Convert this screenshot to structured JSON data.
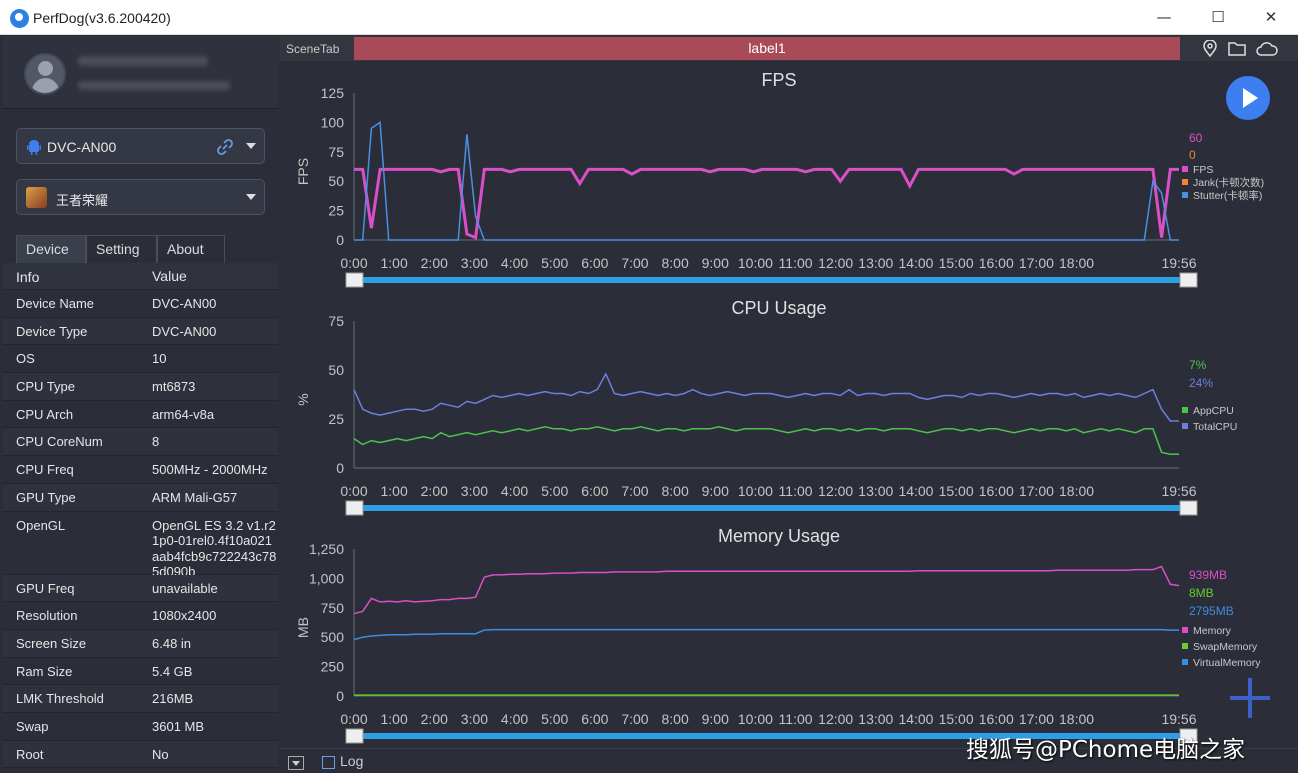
{
  "window": {
    "title": "PerfDog(v3.6.200420)",
    "minimize": "—",
    "maximize": "☐",
    "close": "✕"
  },
  "sidebar": {
    "device_select": {
      "value": "DVC-AN00"
    },
    "app_select": {
      "value": "王者荣耀"
    },
    "tabs": [
      {
        "label": "Device"
      },
      {
        "label": "Setting"
      },
      {
        "label": "About"
      }
    ],
    "table": {
      "headers": [
        "Info",
        "Value"
      ],
      "rows": [
        {
          "k": "Device Name",
          "v": "DVC-AN00"
        },
        {
          "k": "Device Type",
          "v": "DVC-AN00"
        },
        {
          "k": "OS",
          "v": "10"
        },
        {
          "k": "CPU Type",
          "v": "mt6873"
        },
        {
          "k": "CPU Arch",
          "v": "arm64-v8a"
        },
        {
          "k": "CPU CoreNum",
          "v": "8"
        },
        {
          "k": "CPU Freq",
          "v": "500MHz - 2000MHz"
        },
        {
          "k": "GPU Type",
          "v": "ARM Mali-G57"
        },
        {
          "k": "OpenGL",
          "v": "OpenGL ES 3.2 v1.r21p0-01rel0.4f10a021aab4fcb9c722243c785d090b"
        },
        {
          "k": "GPU Freq",
          "v": "unavailable"
        },
        {
          "k": "Resolution",
          "v": "1080x2400"
        },
        {
          "k": "Screen Size",
          "v": "6.48 in"
        },
        {
          "k": "Ram Size",
          "v": "5.4 GB"
        },
        {
          "k": "LMK Threshold",
          "v": "216MB"
        },
        {
          "k": "Swap",
          "v": "3601 MB"
        },
        {
          "k": "Root",
          "v": "No"
        }
      ]
    }
  },
  "main": {
    "scene_tab": "SceneTab",
    "label": "label1",
    "icons": [
      "location-icon",
      "folder-icon",
      "cloud-icon"
    ],
    "bottom": {
      "log_label": "Log"
    }
  },
  "watermark": "搜狐号@PChome电脑之家",
  "colors": {
    "fps": "#d94fc7",
    "jank": "#e8863a",
    "stutter": "#4a90e2",
    "app_cpu": "#4cc44c",
    "total_cpu": "#6c7fe0",
    "memory": "#d94fc7",
    "swap": "#66cc33",
    "virtual": "#3a8ee0",
    "accent": "#3d7ef0",
    "label_bar": "#a84a58"
  },
  "chart_data": [
    {
      "type": "line",
      "title": "FPS",
      "ylabel": "FPS",
      "ylim": [
        0,
        125
      ],
      "yticks": [
        "125",
        "100",
        "75",
        "50",
        "25",
        "0"
      ],
      "xticks": [
        "0:00",
        "1:00",
        "2:00",
        "3:00",
        "4:00",
        "5:00",
        "6:00",
        "7:00",
        "8:00",
        "9:00",
        "10:00",
        "11:00",
        "12:00",
        "13:00",
        "14:00",
        "15:00",
        "16:00",
        "17:00",
        "18:00",
        "19:56"
      ],
      "legend": [
        "FPS",
        "Jank(卡顿次数)",
        "Stutter(卡顿率)"
      ],
      "current_values": [
        "60",
        "0"
      ],
      "series": [
        {
          "name": "FPS",
          "values": [
            60,
            60,
            10,
            60,
            60,
            60,
            60,
            60,
            60,
            60,
            58,
            60,
            60,
            5,
            2,
            60,
            60,
            60,
            58,
            60,
            60,
            60,
            60,
            60,
            60,
            60,
            48,
            60,
            60,
            60,
            60,
            60,
            56,
            60,
            60,
            60,
            60,
            60,
            60,
            60,
            60,
            58,
            60,
            60,
            60,
            60,
            58,
            60,
            60,
            60,
            60,
            60,
            58,
            60,
            60,
            60,
            50,
            60,
            60,
            60,
            60,
            60,
            60,
            60,
            46,
            60,
            60,
            60,
            60,
            60,
            60,
            60,
            60,
            60,
            60,
            60,
            56,
            60,
            60,
            60,
            60,
            60,
            60,
            60,
            60,
            60,
            60,
            60,
            60,
            60,
            60,
            60,
            60,
            2,
            60,
            60
          ]
        },
        {
          "name": "Stutter(卡顿率)",
          "values": [
            0,
            0,
            95,
            100,
            0,
            0,
            0,
            0,
            0,
            0,
            0,
            0,
            0,
            90,
            20,
            0,
            0,
            0,
            0,
            0,
            0,
            0,
            0,
            0,
            0,
            0,
            0,
            0,
            0,
            0,
            0,
            0,
            0,
            0,
            0,
            0,
            0,
            0,
            0,
            0,
            0,
            0,
            0,
            0,
            0,
            0,
            0,
            0,
            0,
            0,
            0,
            0,
            0,
            0,
            0,
            0,
            0,
            0,
            0,
            0,
            0,
            0,
            0,
            0,
            0,
            0,
            0,
            0,
            0,
            0,
            0,
            0,
            0,
            0,
            0,
            0,
            0,
            0,
            0,
            0,
            0,
            0,
            0,
            0,
            0,
            0,
            0,
            0,
            0,
            0,
            0,
            0,
            50,
            40,
            0,
            0
          ]
        }
      ]
    },
    {
      "type": "line",
      "title": "CPU Usage",
      "ylabel": "%",
      "ylim": [
        0,
        75
      ],
      "yticks": [
        "75",
        "50",
        "25",
        "0"
      ],
      "xticks": [
        "0:00",
        "1:00",
        "2:00",
        "3:00",
        "4:00",
        "5:00",
        "6:00",
        "7:00",
        "8:00",
        "9:00",
        "10:00",
        "11:00",
        "12:00",
        "13:00",
        "14:00",
        "15:00",
        "16:00",
        "17:00",
        "18:00",
        "19:56"
      ],
      "legend": [
        "AppCPU",
        "TotalCPU"
      ],
      "current_values": [
        "7%",
        "24%"
      ],
      "series": [
        {
          "name": "AppCPU",
          "values": [
            15,
            12,
            14,
            13,
            14,
            15,
            14,
            15,
            16,
            15,
            18,
            16,
            17,
            18,
            17,
            18,
            19,
            18,
            19,
            20,
            19,
            20,
            21,
            20,
            20,
            19,
            20,
            20,
            21,
            20,
            19,
            20,
            20,
            21,
            20,
            19,
            20,
            20,
            19,
            20,
            20,
            20,
            21,
            20,
            19,
            20,
            20,
            20,
            20,
            19,
            18,
            19,
            20,
            19,
            20,
            20,
            19,
            20,
            19,
            20,
            20,
            19,
            20,
            20,
            20,
            19,
            18,
            19,
            20,
            20,
            19,
            20,
            19,
            20,
            20,
            19,
            18,
            19,
            20,
            19,
            20,
            20,
            19,
            20,
            18,
            19,
            20,
            19,
            20,
            19,
            18,
            20,
            20,
            8,
            7,
            7
          ]
        },
        {
          "name": "TotalCPU",
          "values": [
            40,
            30,
            28,
            27,
            28,
            29,
            30,
            30,
            29,
            30,
            33,
            32,
            31,
            34,
            33,
            35,
            37,
            36,
            37,
            38,
            37,
            38,
            39,
            38,
            38,
            37,
            39,
            38,
            40,
            48,
            38,
            37,
            38,
            39,
            38,
            37,
            38,
            37,
            38,
            40,
            38,
            37,
            38,
            39,
            38,
            37,
            38,
            38,
            38,
            37,
            36,
            37,
            38,
            37,
            38,
            38,
            37,
            40,
            37,
            38,
            38,
            37,
            38,
            38,
            38,
            36,
            35,
            36,
            37,
            37,
            36,
            38,
            37,
            38,
            38,
            37,
            36,
            37,
            38,
            37,
            38,
            38,
            37,
            38,
            36,
            37,
            38,
            37,
            38,
            37,
            36,
            38,
            40,
            30,
            24,
            24
          ]
        }
      ]
    },
    {
      "type": "line",
      "title": "Memory Usage",
      "ylabel": "MB",
      "ylim": [
        0,
        1250
      ],
      "yticks": [
        "1,250",
        "1,000",
        "750",
        "500",
        "250",
        "0"
      ],
      "xticks": [
        "0:00",
        "1:00",
        "2:00",
        "3:00",
        "4:00",
        "5:00",
        "6:00",
        "7:00",
        "8:00",
        "9:00",
        "10:00",
        "11:00",
        "12:00",
        "13:00",
        "14:00",
        "15:00",
        "16:00",
        "17:00",
        "18:00",
        "19:56"
      ],
      "legend": [
        "Memory",
        "SwapMemory",
        "VirtualMemory"
      ],
      "current_values": [
        "939MB",
        "8MB",
        "2795MB"
      ],
      "series": [
        {
          "name": "Memory",
          "values": [
            700,
            720,
            830,
            800,
            805,
            800,
            810,
            800,
            805,
            810,
            820,
            820,
            830,
            830,
            840,
            1010,
            1030,
            1030,
            1035,
            1035,
            1040,
            1040,
            1040,
            1045,
            1045,
            1045,
            1050,
            1050,
            1050,
            1050,
            1055,
            1055,
            1055,
            1055,
            1055,
            1055,
            1060,
            1060,
            1060,
            1060,
            1060,
            1060,
            1060,
            1060,
            1060,
            1060,
            1060,
            1060,
            1060,
            1060,
            1060,
            1060,
            1060,
            1060,
            1060,
            1060,
            1060,
            1060,
            1060,
            1060,
            1060,
            1060,
            1060,
            1060,
            1060,
            1065,
            1065,
            1065,
            1065,
            1065,
            1065,
            1065,
            1065,
            1065,
            1065,
            1065,
            1065,
            1065,
            1065,
            1065,
            1065,
            1070,
            1070,
            1070,
            1070,
            1070,
            1070,
            1070,
            1070,
            1070,
            1075,
            1075,
            1075,
            1100,
            950,
            939
          ]
        },
        {
          "name": "SwapMemory",
          "values": [
            8,
            8,
            8,
            8,
            8,
            8,
            8,
            8,
            8,
            8,
            8,
            8,
            8,
            8,
            8,
            8,
            8,
            8,
            8,
            8,
            8,
            8,
            8,
            8,
            8,
            8,
            8,
            8,
            8,
            8,
            8,
            8,
            8,
            8,
            8,
            8,
            8,
            8,
            8,
            8,
            8,
            8,
            8,
            8,
            8,
            8,
            8,
            8,
            8,
            8,
            8,
            8,
            8,
            8,
            8,
            8,
            8,
            8,
            8,
            8,
            8,
            8,
            8,
            8,
            8,
            8,
            8,
            8,
            8,
            8,
            8,
            8,
            8,
            8,
            8,
            8,
            8,
            8,
            8,
            8,
            8,
            8,
            8,
            8,
            8,
            8,
            8,
            8,
            8,
            8,
            8,
            8,
            8,
            8,
            8,
            8
          ]
        },
        {
          "name": "VirtualMemory",
          "values": [
            480,
            500,
            510,
            515,
            520,
            520,
            520,
            525,
            525,
            525,
            530,
            530,
            530,
            530,
            530,
            560,
            565,
            565,
            565,
            565,
            565,
            565,
            565,
            565,
            565,
            565,
            565,
            565,
            565,
            565,
            565,
            565,
            565,
            565,
            565,
            565,
            565,
            565,
            565,
            565,
            565,
            565,
            565,
            565,
            565,
            565,
            565,
            565,
            565,
            565,
            565,
            565,
            565,
            565,
            565,
            565,
            565,
            565,
            565,
            565,
            565,
            565,
            565,
            565,
            565,
            565,
            565,
            565,
            565,
            565,
            565,
            565,
            565,
            565,
            565,
            565,
            565,
            565,
            565,
            565,
            565,
            565,
            565,
            565,
            565,
            565,
            565,
            565,
            565,
            565,
            565,
            565,
            565,
            565,
            560,
            560
          ]
        }
      ]
    }
  ]
}
